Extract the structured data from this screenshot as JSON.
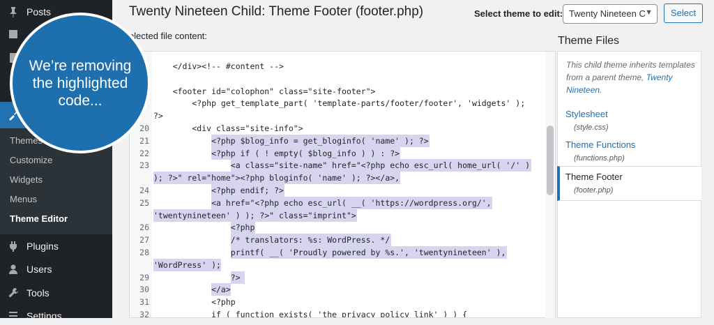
{
  "sidebar": {
    "menu": [
      {
        "label": "Posts",
        "icon": "pushpin-icon"
      },
      {
        "label": "Plugins",
        "icon": "plugin-icon"
      },
      {
        "label": "Users",
        "icon": "users-icon"
      },
      {
        "label": "Tools",
        "icon": "wrench-icon"
      },
      {
        "label": "Settings",
        "icon": "sliders-icon"
      }
    ],
    "submenu": [
      "Themes",
      "Customize",
      "Widgets",
      "Menus",
      "Theme Editor"
    ],
    "current_submenu": "Theme Editor"
  },
  "header": {
    "title": "Twenty Nineteen Child: Theme Footer (footer.php)",
    "select_label": "Select theme to edit:",
    "select_value": "Twenty Nineteen C",
    "select_button": "Select"
  },
  "editor": {
    "label": "elected file content:",
    "lines": [
      {
        "n": "",
        "text": "    </div><!-- #content -->",
        "hl": false
      },
      {
        "n": "",
        "text": "",
        "hl": false
      },
      {
        "n": "",
        "text": "    <footer id=\"colophon\" class=\"site-footer\">",
        "hl": false
      },
      {
        "n": "",
        "text": "        <?php get_template_part( 'template-parts/footer/footer', 'widgets' );",
        "hl": false
      },
      {
        "n": "",
        "text": "?>",
        "hl": false,
        "wrap": true
      },
      {
        "n": "20",
        "text": "        <div class=\"site-info\">",
        "hl": false
      },
      {
        "n": "21",
        "text": "            <?php $blog_info = get_bloginfo( 'name' ); ?>",
        "hl": true
      },
      {
        "n": "22",
        "text": "            <?php if ( ! empty( $blog_info ) ) : ?>",
        "hl": true
      },
      {
        "n": "23",
        "text": "                <a class=\"site-name\" href=\"<?php echo esc_url( home_url( '/' )",
        "hl": true
      },
      {
        "n": "",
        "text": "); ?>\" rel=\"home\"><?php bloginfo( 'name' ); ?></a>,",
        "hl": true,
        "wrap": true
      },
      {
        "n": "24",
        "text": "            <?php endif; ?>",
        "hl": true
      },
      {
        "n": "25",
        "text": "            <a href=\"<?php echo esc_url( __( 'https://wordpress.org/',",
        "hl": true
      },
      {
        "n": "",
        "text": "'twentynineteen' ) ); ?>\" class=\"imprint\">",
        "hl": true,
        "wrap": true
      },
      {
        "n": "26",
        "text": "                <?php",
        "hl": true
      },
      {
        "n": "27",
        "text": "                /* translators: %s: WordPress. */",
        "hl": true
      },
      {
        "n": "28",
        "text": "                printf( __( 'Proudly powered by %s.', 'twentynineteen' ),",
        "hl": true
      },
      {
        "n": "",
        "text": "'WordPress' );",
        "hl": true,
        "wrap": true
      },
      {
        "n": "29",
        "text": "                ?>",
        "hl": true
      },
      {
        "n": "30",
        "text": "            </a>",
        "hl": true
      },
      {
        "n": "31",
        "text": "            <?php",
        "hl": false
      },
      {
        "n": "32",
        "text": "            if ( function_exists( 'the_privacy_policy_link' ) ) {",
        "hl": false
      }
    ]
  },
  "files": {
    "title": "Theme Files",
    "note_prefix": "This child theme inherits templates from a parent theme,",
    "note_link": "Twenty Nineteen",
    "note_suffix": ".",
    "items": [
      {
        "name": "Stylesheet",
        "path": "(style.css)"
      },
      {
        "name": "Theme Functions",
        "path": "(functions.php)"
      },
      {
        "name": "Theme Footer",
        "path": "(footer.php)"
      }
    ]
  },
  "callout": {
    "text": "We’re removing the highlighted code..."
  },
  "colors": {
    "sidebar_bg": "#1d2327",
    "accent": "#2271b1",
    "highlight": "#d7d4f0",
    "callout_bg": "#1d6fae"
  }
}
